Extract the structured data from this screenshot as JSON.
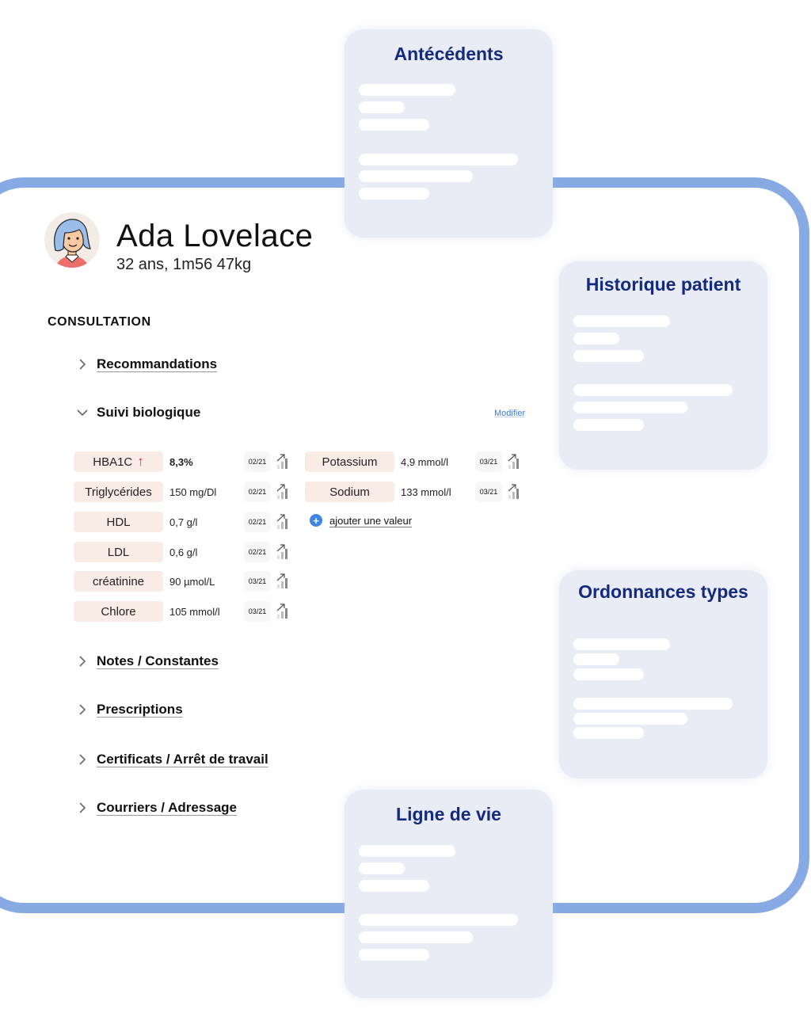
{
  "patient": {
    "name": "Ada Lovelace",
    "info": "32 ans, 1m56 47kg",
    "avatar_icon": "woman-avatar-icon"
  },
  "consultation": {
    "title": "CONSULTATION",
    "sections": [
      {
        "label": "Recommandations",
        "expanded": false
      },
      {
        "label": "Suivi biologique",
        "expanded": true
      },
      {
        "label": "Notes / Constantes",
        "expanded": false
      },
      {
        "label": "Prescriptions",
        "expanded": false
      },
      {
        "label": "Certificats / Arrêt de travail",
        "expanded": false
      },
      {
        "label": "Courriers / Adressage",
        "expanded": false
      }
    ],
    "bio": {
      "modify_label": "Modifier",
      "left_column": [
        {
          "name": "HBA1C",
          "value": "8,3%",
          "date": "02/21",
          "alert": "up-arrow-icon",
          "alert_color": "#e02424"
        },
        {
          "name": "Triglycérides",
          "value": "150 mg/Dl",
          "date": "02/21"
        },
        {
          "name": "HDL",
          "value": "0,7 g/l",
          "date": "02/21"
        },
        {
          "name": "LDL",
          "value": "0,6 g/l",
          "date": "02/21"
        },
        {
          "name": "créatinine",
          "value": "90 µmol/L",
          "date": "03/21"
        },
        {
          "name": "Chlore",
          "value": "105 mmol/l",
          "date": "03/21"
        }
      ],
      "right_column": [
        {
          "name": "Potassium",
          "value": "4,9 mmol/l",
          "date": "03/21"
        },
        {
          "name": "Sodium",
          "value": "133 mmol/l",
          "date": "03/21"
        }
      ],
      "add_value_label": "ajouter une valeur"
    }
  },
  "cards": [
    {
      "title": "Antécédents"
    },
    {
      "title": "Historique patient"
    },
    {
      "title": "Ordonnances types"
    },
    {
      "title": "Ligne de vie"
    }
  ],
  "colors": {
    "frame": "#87aae4",
    "card_bg": "#e9ecf5",
    "card_title": "#132a7e",
    "bio_label_bg": "#f9ebe6",
    "link_blue": "#3d7bd9",
    "alert_red": "#e02424"
  }
}
